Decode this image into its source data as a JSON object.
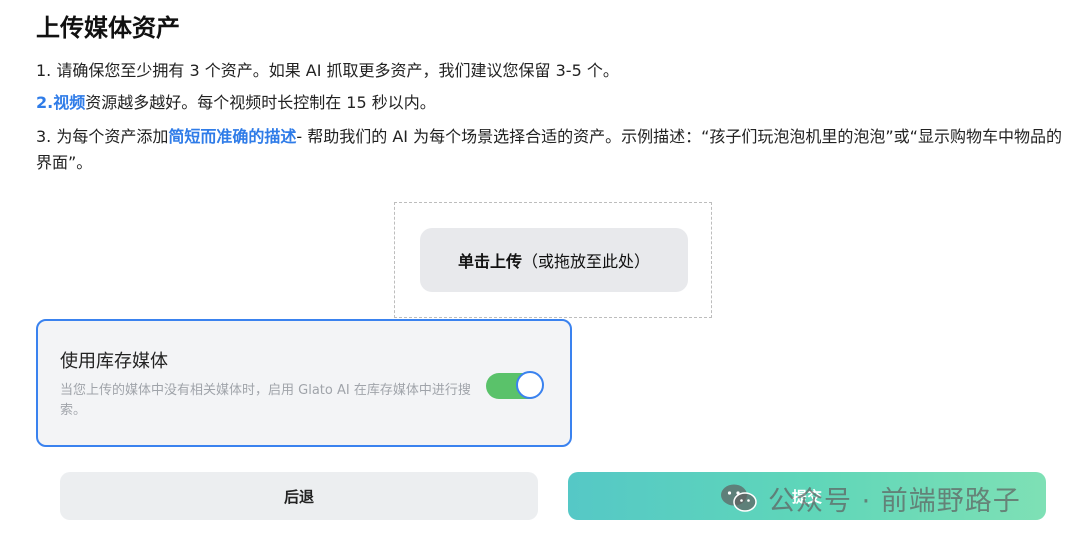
{
  "page_title": "上传媒体资产",
  "instructions": {
    "line1": "1. 请确保您至少拥有 3 个资产。如果 AI 抓取更多资产，我们建议您保留 3-5 个。",
    "line2_highlight": "2.视频",
    "line2_rest": "资源越多越好。每个视频时长控制在 15 秒以内。",
    "line3_prefix": "3. 为每个资产添加",
    "line3_highlight": "简短而准确的描述",
    "line3_rest": "- 帮助我们的 AI 为每个场景选择合适的资产。示例描述：“孩子们玩泡泡机里的泡泡”或“显示购物车中物品的界面”。"
  },
  "upload": {
    "label_bold": "单击上传",
    "label_rest": "（或拖放至此处）"
  },
  "stock_media": {
    "title": "使用库存媒体",
    "description": "当您上传的媒体中没有相关媒体时，启用 Glato AI 在库存媒体中进行搜索。",
    "enabled": true,
    "toggle_color": "#5ac26a"
  },
  "buttons": {
    "back": "后退",
    "submit": "提交"
  },
  "watermark": {
    "text": "公众号 · 前端野路子",
    "icon": "wechat-icon"
  },
  "colors": {
    "accent": "#3a82ef",
    "highlight": "#2f7ce8",
    "submit_start": "#55c8c6",
    "submit_end": "#7ee0b5"
  }
}
